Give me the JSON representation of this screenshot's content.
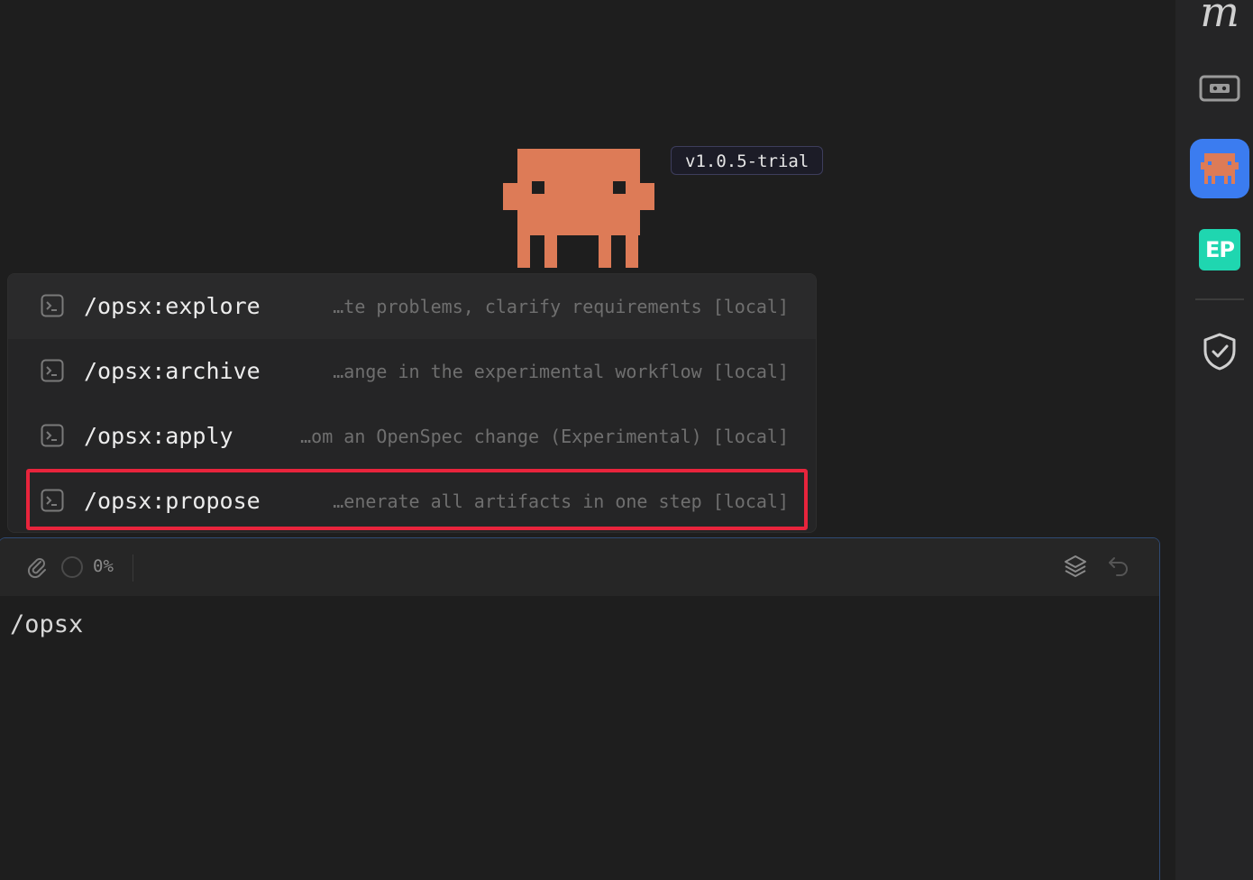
{
  "sidebar": {
    "logo_text": "m",
    "items": [
      {
        "name": "game-controller-icon"
      },
      {
        "name": "mascot-app-icon",
        "active": true
      },
      {
        "name": "ep-app-icon",
        "label": "EP"
      },
      {
        "name": "shield-check-icon"
      }
    ]
  },
  "mascot": {
    "color": "#dd7b57",
    "version": "v1.0.5-trial"
  },
  "command_menu": {
    "items": [
      {
        "name": "/opsx:explore",
        "description": "…te problems, clarify requirements [local]",
        "icon": "terminal-icon"
      },
      {
        "name": "/opsx:archive",
        "description": "…ange in the experimental workflow [local]",
        "icon": "terminal-icon"
      },
      {
        "name": "/opsx:apply",
        "description": "…om an OpenSpec change (Experimental) [local]",
        "icon": "terminal-icon"
      },
      {
        "name": "/opsx:propose",
        "description": "…enerate all artifacts in one step [local]",
        "icon": "terminal-icon",
        "highlighted": true
      }
    ]
  },
  "input_panel": {
    "progress_label": "0%",
    "progress_value": 0,
    "text": "/opsx"
  },
  "colors": {
    "background": "#1e1e1e",
    "accent": "#3b7cf0",
    "highlight": "#e8243c",
    "ep_badge": "#1fd6b0"
  }
}
